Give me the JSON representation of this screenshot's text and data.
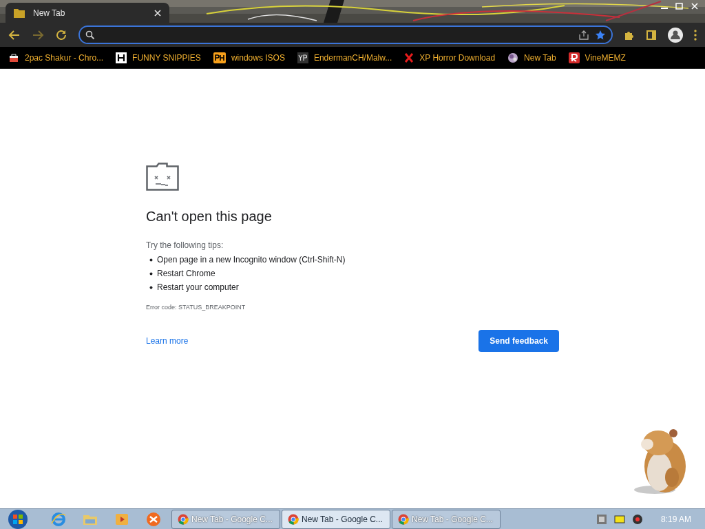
{
  "tabs": [
    {
      "title": "New Tab",
      "selected": true
    }
  ],
  "bookmarks": [
    {
      "label": "2pac Shakur - Chro...",
      "kind": "bag"
    },
    {
      "label": "FUNNY SNIPPIES",
      "kind": "h"
    },
    {
      "label": "windows ISOS",
      "kind": "ph"
    },
    {
      "label": "EndermanCH/Malw...",
      "kind": "yp"
    },
    {
      "label": "XP Horror Download",
      "kind": "x"
    },
    {
      "label": "New Tab",
      "kind": "globe"
    },
    {
      "label": "VineMEMZ",
      "kind": "r"
    }
  ],
  "error_page": {
    "title": "Can't open this page",
    "tips_intro": "Try the following tips:",
    "tips": [
      "Open page in a new Incognito window (Ctrl-Shift-N)",
      "Restart Chrome",
      "Restart your computer"
    ],
    "error_code": "Error code: STATUS_BREAKPOINT",
    "learn_more": "Learn more",
    "feedback_button": "Send feedback"
  },
  "taskbar": {
    "tasks": [
      {
        "label": "New Tab - Google C...",
        "selected": false
      },
      {
        "label": "New Tab - Google C...",
        "selected": true
      },
      {
        "label": "New Tab - Google C...",
        "selected": false
      }
    ],
    "clock": "8:19 AM"
  }
}
